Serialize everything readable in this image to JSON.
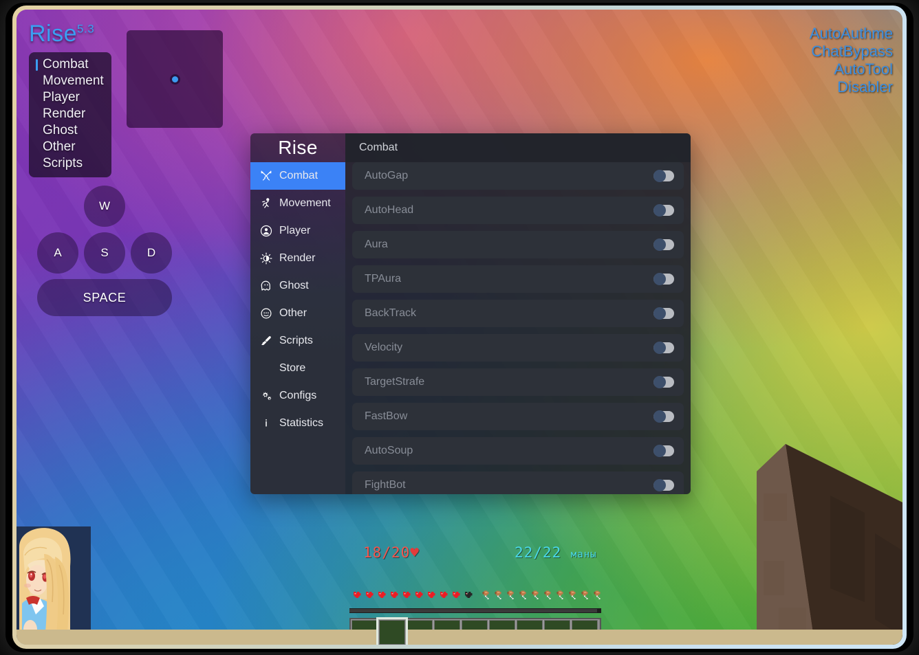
{
  "hud": {
    "client_name": "Rise",
    "client_version": "5.3",
    "accent_color": "#3b9ef2",
    "tab_gui": {
      "items": [
        {
          "label": "Combat",
          "active": true
        },
        {
          "label": "Movement",
          "active": false
        },
        {
          "label": "Player",
          "active": false
        },
        {
          "label": "Render",
          "active": false
        },
        {
          "label": "Ghost",
          "active": false
        },
        {
          "label": "Other",
          "active": false
        },
        {
          "label": "Scripts",
          "active": false
        }
      ]
    },
    "radar": {
      "name": "radar-panel"
    },
    "keystrokes": [
      {
        "key": "W",
        "name": "key-w"
      },
      {
        "key": "A",
        "name": "key-a"
      },
      {
        "key": "S",
        "name": "key-s"
      },
      {
        "key": "D",
        "name": "key-d"
      },
      {
        "key": "SPACE",
        "name": "key-space"
      }
    ],
    "arraylist": {
      "color": "#3c8fe0",
      "modules": [
        "AutoAuthme",
        "ChatBypass",
        "AutoTool",
        "Disabler"
      ]
    },
    "status": {
      "health": "18/20",
      "health_icon": "♥",
      "health_color": "#f4554e",
      "mana": "22/22",
      "mana_unit": "маны",
      "mana_color": "#49d7e8",
      "hearts_full": 9,
      "hearts_empty": 1,
      "food_full": 10,
      "hotbar_slots": 9,
      "hotbar_selected": 2
    }
  },
  "clickgui": {
    "logo": "Rise",
    "category_header": "Combat",
    "active_color": "#3b82f6",
    "nav": [
      {
        "label": "Combat",
        "icon": "crossed-swords-icon",
        "active": true
      },
      {
        "label": "Movement",
        "icon": "running-man-icon",
        "active": false
      },
      {
        "label": "Player",
        "icon": "person-circle-icon",
        "active": false
      },
      {
        "label": "Render",
        "icon": "brightness-icon",
        "active": false
      },
      {
        "label": "Ghost",
        "icon": "ghost-icon",
        "active": false
      },
      {
        "label": "Other",
        "icon": "smiley-circle-icon",
        "active": false
      },
      {
        "label": "Scripts",
        "icon": "paintbrush-icon",
        "active": false
      },
      {
        "label": "Store",
        "icon": "none",
        "active": false
      },
      {
        "label": "Configs",
        "icon": "gears-icon",
        "active": false
      },
      {
        "label": "Statistics",
        "icon": "info-icon",
        "active": false
      }
    ],
    "modules": [
      {
        "name": "AutoGap",
        "enabled": false
      },
      {
        "name": "AutoHead",
        "enabled": false
      },
      {
        "name": "Aura",
        "enabled": false
      },
      {
        "name": "TPAura",
        "enabled": false
      },
      {
        "name": "BackTrack",
        "enabled": false
      },
      {
        "name": "Velocity",
        "enabled": false
      },
      {
        "name": "TargetStrafe",
        "enabled": false
      },
      {
        "name": "FastBow",
        "enabled": false
      },
      {
        "name": "AutoSoup",
        "enabled": false
      },
      {
        "name": "FightBot",
        "enabled": false
      }
    ]
  }
}
